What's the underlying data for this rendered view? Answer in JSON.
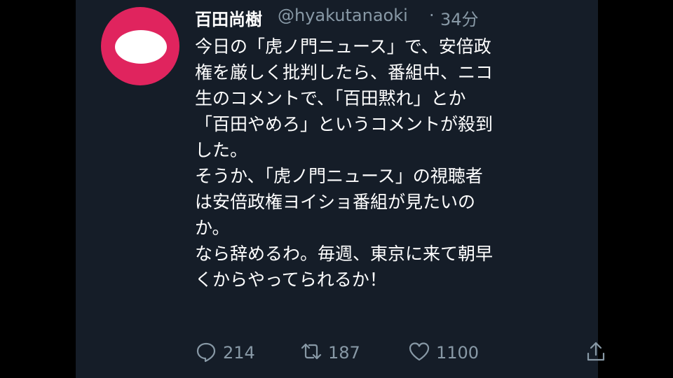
{
  "tweet": {
    "display_name": "百田尚樹",
    "handle": "@hyakutanaoki",
    "separator": "·",
    "time": "34分",
    "body_lines": [
      "今日の「虎ノ門ニュース」で、安倍政",
      "権を厳しく批判したら、番組中、ニコ",
      "生のコメントで、「百田黙れ」とか",
      "「百田やめろ」というコメントが殺到",
      "した。",
      "そうか、「虎ノ門ニュース」の視聴者",
      "は安倍政権ヨイショ番組が見たいの",
      "か。",
      "なら辞めるわ。毎週、東京に来て朝早",
      "くからやってられるか！"
    ],
    "actions": {
      "reply_count": "214",
      "retweet_count": "187",
      "like_count": "1100"
    }
  },
  "icons": {
    "avatar": "avatar",
    "chevron": "chevron-down-icon",
    "reply": "reply-icon",
    "retweet": "retweet-icon",
    "like": "heart-icon",
    "share": "share-icon"
  },
  "colors": {
    "background": "#000000",
    "panel": "#151d28",
    "text_primary": "#ffffff",
    "text_secondary": "#8899a6",
    "avatar_accent": "#e0245e"
  }
}
